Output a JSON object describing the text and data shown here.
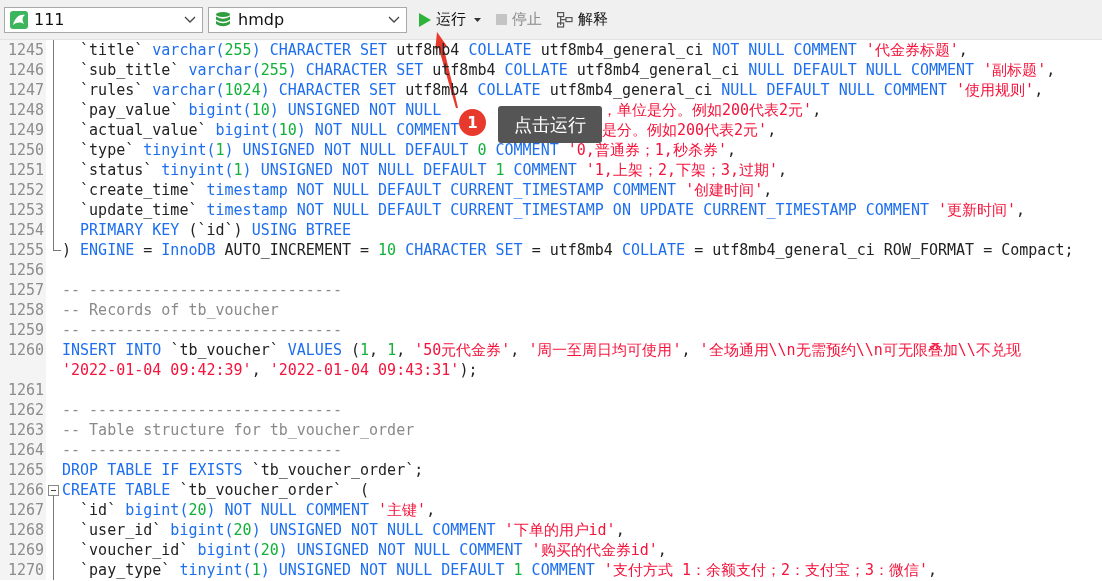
{
  "toolbar": {
    "connection": {
      "value": "111"
    },
    "database": {
      "value": "hmdp"
    },
    "buttons": [
      {
        "kind": "run",
        "label": "运行",
        "disabled": false,
        "dropdown": true
      },
      {
        "kind": "stop",
        "label": "停止",
        "disabled": true,
        "dropdown": false
      },
      {
        "kind": "explain",
        "label": "解释",
        "disabled": false,
        "dropdown": false
      }
    ]
  },
  "editor": {
    "lines": [
      {
        "number": "1245",
        "in_block": true,
        "tokens": [
          {
            "kind": "plain",
            "text": "`title` "
          },
          {
            "kind": "keyword",
            "text": "varchar("
          },
          {
            "kind": "number",
            "text": "255"
          },
          {
            "kind": "keyword",
            "text": ") CHARACTER SET "
          },
          {
            "kind": "plain",
            "text": "utf8mb4 "
          },
          {
            "kind": "keyword",
            "text": "COLLATE "
          },
          {
            "kind": "plain",
            "text": "utf8mb4_general_ci "
          },
          {
            "kind": "keyword",
            "text": "NOT NULL COMMENT "
          },
          {
            "kind": "string",
            "text": "'代金券标题'"
          },
          {
            "kind": "plain",
            "text": ","
          }
        ]
      },
      {
        "number": "1246",
        "in_block": true,
        "tokens": [
          {
            "kind": "plain",
            "text": "`sub_title` "
          },
          {
            "kind": "keyword",
            "text": "varchar("
          },
          {
            "kind": "number",
            "text": "255"
          },
          {
            "kind": "keyword",
            "text": ") CHARACTER SET "
          },
          {
            "kind": "plain",
            "text": "utf8mb4 "
          },
          {
            "kind": "keyword",
            "text": "COLLATE "
          },
          {
            "kind": "plain",
            "text": "utf8mb4_general_ci "
          },
          {
            "kind": "keyword",
            "text": "NULL DEFAULT NULL COMMENT "
          },
          {
            "kind": "string",
            "text": "'副标题'"
          },
          {
            "kind": "plain",
            "text": ","
          }
        ]
      },
      {
        "number": "1247",
        "in_block": true,
        "tokens": [
          {
            "kind": "plain",
            "text": "`rules` "
          },
          {
            "kind": "keyword",
            "text": "varchar("
          },
          {
            "kind": "number",
            "text": "1024"
          },
          {
            "kind": "keyword",
            "text": ") CHARACTER SET "
          },
          {
            "kind": "plain",
            "text": "utf8mb4 "
          },
          {
            "kind": "keyword",
            "text": "COLLATE "
          },
          {
            "kind": "plain",
            "text": "utf8mb4_general_ci "
          },
          {
            "kind": "keyword",
            "text": "NULL DEFAULT NULL COMMENT "
          },
          {
            "kind": "string",
            "text": "'使用规则'"
          },
          {
            "kind": "plain",
            "text": ","
          }
        ]
      },
      {
        "number": "1248",
        "in_block": true,
        "tokens": [
          {
            "kind": "plain",
            "text": "`pay_value` "
          },
          {
            "kind": "keyword",
            "text": "bigint("
          },
          {
            "kind": "number",
            "text": "10"
          },
          {
            "kind": "keyword",
            "text": ") UNSIGNED NOT NULL "
          },
          {
            "kind": "covered"
          },
          {
            "kind": "string",
            "text": "，单位是分。例如200代表2元'"
          },
          {
            "kind": "plain",
            "text": ","
          }
        ]
      },
      {
        "number": "1249",
        "in_block": true,
        "tokens": [
          {
            "kind": "plain",
            "text": "`actual_value` "
          },
          {
            "kind": "keyword",
            "text": "bigint("
          },
          {
            "kind": "number",
            "text": "10"
          },
          {
            "kind": "keyword",
            "text": ") NOT NULL COMMENT "
          },
          {
            "kind": "covered"
          },
          {
            "kind": "string",
            "text": "是分。例如200代表2元'"
          },
          {
            "kind": "plain",
            "text": ","
          }
        ]
      },
      {
        "number": "1250",
        "in_block": true,
        "tokens": [
          {
            "kind": "plain",
            "text": "`type` "
          },
          {
            "kind": "keyword",
            "text": "tinyint("
          },
          {
            "kind": "number",
            "text": "1"
          },
          {
            "kind": "keyword",
            "text": ") UNSIGNED NOT NULL DEFAULT "
          },
          {
            "kind": "number",
            "text": "0"
          },
          {
            "kind": "keyword",
            "text": " COMMENT "
          },
          {
            "kind": "string",
            "text": "'0,普通券；1,秒杀券'"
          },
          {
            "kind": "plain",
            "text": ","
          }
        ]
      },
      {
        "number": "1251",
        "in_block": true,
        "tokens": [
          {
            "kind": "plain",
            "text": "`status` "
          },
          {
            "kind": "keyword",
            "text": "tinyint("
          },
          {
            "kind": "number",
            "text": "1"
          },
          {
            "kind": "keyword",
            "text": ") UNSIGNED NOT NULL DEFAULT "
          },
          {
            "kind": "number",
            "text": "1"
          },
          {
            "kind": "keyword",
            "text": " COMMENT "
          },
          {
            "kind": "string",
            "text": "'1,上架；2,下架；3,过期'"
          },
          {
            "kind": "plain",
            "text": ","
          }
        ]
      },
      {
        "number": "1252",
        "in_block": true,
        "tokens": [
          {
            "kind": "plain",
            "text": "`create_time` "
          },
          {
            "kind": "keyword",
            "text": "timestamp NOT NULL DEFAULT CURRENT_TIMESTAMP COMMENT "
          },
          {
            "kind": "string",
            "text": "'创建时间'"
          },
          {
            "kind": "plain",
            "text": ","
          }
        ]
      },
      {
        "number": "1253",
        "in_block": true,
        "tokens": [
          {
            "kind": "plain",
            "text": "`update_time` "
          },
          {
            "kind": "keyword",
            "text": "timestamp NOT NULL DEFAULT CURRENT_TIMESTAMP ON UPDATE CURRENT_TIMESTAMP COMMENT "
          },
          {
            "kind": "string",
            "text": "'更新时间'"
          },
          {
            "kind": "plain",
            "text": ","
          }
        ]
      },
      {
        "number": "1254",
        "in_block": true,
        "tokens": [
          {
            "kind": "keyword",
            "text": "PRIMARY KEY "
          },
          {
            "kind": "plain",
            "text": "(`id`) "
          },
          {
            "kind": "keyword",
            "text": "USING BTREE"
          }
        ]
      },
      {
        "number": "1255",
        "block_end": true,
        "tokens": [
          {
            "kind": "plain",
            "text": ") "
          },
          {
            "kind": "keyword",
            "text": "ENGINE "
          },
          {
            "kind": "plain",
            "text": "= "
          },
          {
            "kind": "keyword",
            "text": "InnoDB "
          },
          {
            "kind": "plain",
            "text": "AUTO_INCREMENT = "
          },
          {
            "kind": "number",
            "text": "10"
          },
          {
            "kind": "keyword",
            "text": " CHARACTER SET "
          },
          {
            "kind": "plain",
            "text": "= utf8mb4 "
          },
          {
            "kind": "keyword",
            "text": "COLLATE "
          },
          {
            "kind": "plain",
            "text": "= utf8mb4_general_ci ROW_FORMAT = Compact;"
          }
        ]
      },
      {
        "number": "1256"
      },
      {
        "number": "1257",
        "tokens": [
          {
            "kind": "comment",
            "text": "-- ----------------------------"
          }
        ]
      },
      {
        "number": "1258",
        "tokens": [
          {
            "kind": "comment",
            "text": "-- Records of tb_voucher"
          }
        ]
      },
      {
        "number": "1259",
        "tokens": [
          {
            "kind": "comment",
            "text": "-- ----------------------------"
          }
        ]
      },
      {
        "number": "1260",
        "tokens": [
          {
            "kind": "keyword",
            "text": "INSERT INTO "
          },
          {
            "kind": "plain",
            "text": "`tb_voucher` "
          },
          {
            "kind": "keyword",
            "text": "VALUES "
          },
          {
            "kind": "plain",
            "text": "("
          },
          {
            "kind": "number",
            "text": "1"
          },
          {
            "kind": "plain",
            "text": ", "
          },
          {
            "kind": "number",
            "text": "1"
          },
          {
            "kind": "plain",
            "text": ", "
          },
          {
            "kind": "string",
            "text": "'50元代金券'"
          },
          {
            "kind": "plain",
            "text": ", "
          },
          {
            "kind": "string",
            "text": "'周一至周日均可使用'"
          },
          {
            "kind": "plain",
            "text": ", "
          },
          {
            "kind": "string",
            "text": "'全场通用\\\\n无需预约\\\\n可无限叠加\\\\不兑现"
          }
        ],
        "wrap_tokens": [
          {
            "kind": "string",
            "text": "'2022-01-04 09:42:39'"
          },
          {
            "kind": "plain",
            "text": ", "
          },
          {
            "kind": "string",
            "text": "'2022-01-04 09:43:31'"
          },
          {
            "kind": "plain",
            "text": ");"
          }
        ]
      },
      {
        "number": "1261"
      },
      {
        "number": "1262",
        "tokens": [
          {
            "kind": "comment",
            "text": "-- ----------------------------"
          }
        ]
      },
      {
        "number": "1263",
        "tokens": [
          {
            "kind": "comment",
            "text": "-- Table structure for tb_voucher_order"
          }
        ]
      },
      {
        "number": "1264",
        "tokens": [
          {
            "kind": "comment",
            "text": "-- ----------------------------"
          }
        ]
      },
      {
        "number": "1265",
        "tokens": [
          {
            "kind": "keyword",
            "text": "DROP TABLE IF EXISTS "
          },
          {
            "kind": "plain",
            "text": "`tb_voucher_order`;"
          }
        ]
      },
      {
        "number": "1266",
        "block_start": true,
        "tokens": [
          {
            "kind": "keyword",
            "text": "CREATE TABLE "
          },
          {
            "kind": "plain",
            "text": "`tb_voucher_order`  ("
          }
        ]
      },
      {
        "number": "1267",
        "in_block": true,
        "tokens": [
          {
            "kind": "plain",
            "text": "`id` "
          },
          {
            "kind": "keyword",
            "text": "bigint("
          },
          {
            "kind": "number",
            "text": "20"
          },
          {
            "kind": "keyword",
            "text": ") NOT NULL COMMENT "
          },
          {
            "kind": "string",
            "text": "'主键'"
          },
          {
            "kind": "plain",
            "text": ","
          }
        ]
      },
      {
        "number": "1268",
        "in_block": true,
        "tokens": [
          {
            "kind": "plain",
            "text": "`user_id` "
          },
          {
            "kind": "keyword",
            "text": "bigint("
          },
          {
            "kind": "number",
            "text": "20"
          },
          {
            "kind": "keyword",
            "text": ") UNSIGNED NOT NULL COMMENT "
          },
          {
            "kind": "string",
            "text": "'下单的用户id'"
          },
          {
            "kind": "plain",
            "text": ","
          }
        ]
      },
      {
        "number": "1269",
        "in_block": true,
        "tokens": [
          {
            "kind": "plain",
            "text": "`voucher_id` "
          },
          {
            "kind": "keyword",
            "text": "bigint("
          },
          {
            "kind": "number",
            "text": "20"
          },
          {
            "kind": "keyword",
            "text": ") UNSIGNED NOT NULL COMMENT "
          },
          {
            "kind": "string",
            "text": "'购买的代金券id'"
          },
          {
            "kind": "plain",
            "text": ","
          }
        ]
      },
      {
        "number": "1270",
        "in_block": true,
        "tokens": [
          {
            "kind": "plain",
            "text": "`pay_type` "
          },
          {
            "kind": "keyword",
            "text": "tinyint("
          },
          {
            "kind": "number",
            "text": "1"
          },
          {
            "kind": "keyword",
            "text": ") UNSIGNED NOT NULL DEFAULT "
          },
          {
            "kind": "number",
            "text": "1"
          },
          {
            "kind": "keyword",
            "text": " COMMENT "
          },
          {
            "kind": "string",
            "text": "'支付方式 1：余额支付；2：支付宝；3：微信'"
          },
          {
            "kind": "plain",
            "text": ","
          }
        ]
      }
    ]
  },
  "annotation": {
    "step": "1",
    "label": "点击运行"
  }
}
